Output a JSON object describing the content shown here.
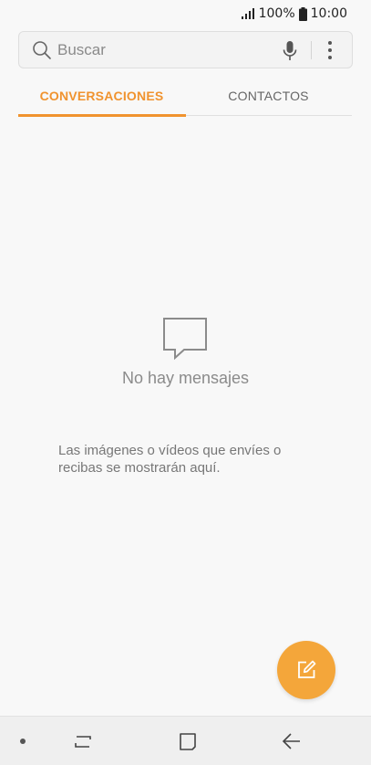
{
  "status_bar": {
    "battery": "100%",
    "time": "10:00",
    "icons": [
      "signal-icon",
      "battery-icon"
    ]
  },
  "search": {
    "placeholder": "Buscar",
    "icons": [
      "search-icon",
      "mic-icon",
      "more-vert-icon"
    ]
  },
  "tabs": [
    {
      "label": "CONVERSACIONES",
      "active": true
    },
    {
      "label": "CONTACTOS",
      "active": false
    }
  ],
  "empty_state": {
    "icon": "message-bubble-icon",
    "title": "No hay mensajes",
    "description": "Las imágenes o vídeos que envíes o recibas se mostrarán aquí."
  },
  "fab": {
    "icon": "compose-icon",
    "color": "#f4a63a"
  },
  "nav_bar": {
    "icons": [
      "nav-dot-icon",
      "recents-icon",
      "home-icon",
      "back-icon"
    ]
  },
  "colors": {
    "accent": "#f0932f",
    "background": "#f8f8f8"
  }
}
